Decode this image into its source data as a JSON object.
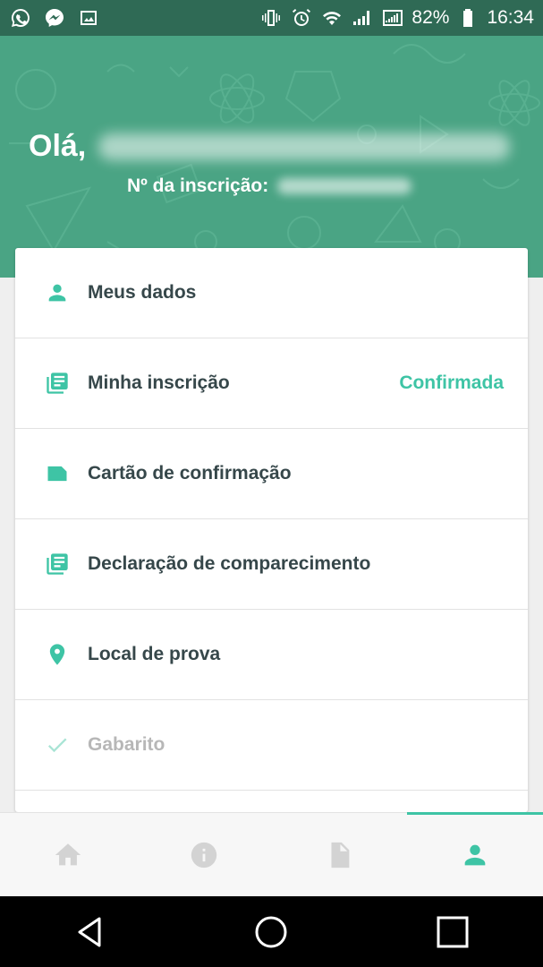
{
  "status_bar": {
    "battery": "82%",
    "time": "16:34",
    "icons": [
      "whatsapp-icon",
      "messenger-icon",
      "gallery-icon",
      "vibrate-icon",
      "alarm-icon",
      "wifi-icon",
      "signal-icon",
      "signal-icon"
    ]
  },
  "header": {
    "greeting": "Olá,",
    "registration_label": "Nº da inscrição:"
  },
  "menu": {
    "items": [
      {
        "label": "Meus dados",
        "icon": "person-icon"
      },
      {
        "label": "Minha inscrição",
        "icon": "document-list-icon",
        "status": "Confirmada"
      },
      {
        "label": "Cartão de confirmação",
        "icon": "card-icon"
      },
      {
        "label": "Declaração de comparecimento",
        "icon": "document-list-icon"
      },
      {
        "label": "Local de prova",
        "icon": "location-pin-icon"
      },
      {
        "label": "Gabarito",
        "icon": "checkmark-icon",
        "disabled": true
      }
    ]
  },
  "bottom_nav": {
    "items": [
      "home-icon",
      "info-icon",
      "document-icon",
      "person-icon"
    ],
    "active": "person-icon"
  },
  "colors": {
    "header_bg": "#4aa484",
    "status_bar_bg": "#2f6a55",
    "accent": "#3ec4a5",
    "text_primary": "#36474a",
    "text_disabled": "#b7b7b7"
  }
}
